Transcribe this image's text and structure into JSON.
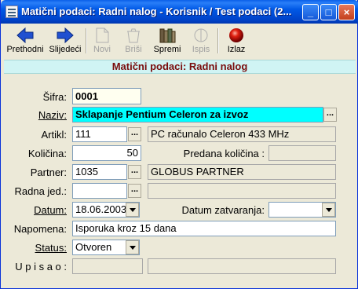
{
  "window": {
    "title": "Matični podaci: Radni nalog - Korisnik / Test podaci (2...",
    "minimize_glyph": "_",
    "maximize_glyph": "□",
    "close_glyph": "×"
  },
  "toolbar": {
    "prev_label": "Prethodni",
    "next_label": "Slijedeći",
    "new_label": "Novi",
    "delete_label": "Briši",
    "save_label": "Spremi",
    "print_label": "Ispis",
    "exit_label": "Izlaz"
  },
  "header": {
    "title": "Matični podaci: Radni nalog"
  },
  "form": {
    "sifra_label": "Šifra:",
    "sifra_value": "0001",
    "naziv_label": "Naziv:",
    "naziv_value": "Sklapanje Pentium Celeron za izvoz",
    "artikl_label": "Artikl:",
    "artikl_code": "111",
    "artikl_name": "PC računalo Celeron 433 MHz",
    "kolicina_label": "Količina:",
    "kolicina_value": "50",
    "predana_label": "Predana količina :",
    "predana_value": "",
    "partner_label": "Partner:",
    "partner_code": "1035",
    "partner_name": "GLOBUS PARTNER",
    "radna_label": "Radna jed.:",
    "radna_code": "",
    "radna_name": "",
    "datum_label": "Datum:",
    "datum_value": "18.06.2003",
    "zatvaranje_label": "Datum zatvaranja:",
    "zatvaranje_value": "",
    "napomena_label": "Napomena:",
    "napomena_value": "Isporuka kroz 15 dana",
    "status_label": "Status:",
    "status_value": "Otvoren",
    "upisao_label": "U p i s a o :",
    "upisao_value1": "",
    "upisao_value2": "",
    "ellipsis": "..."
  }
}
